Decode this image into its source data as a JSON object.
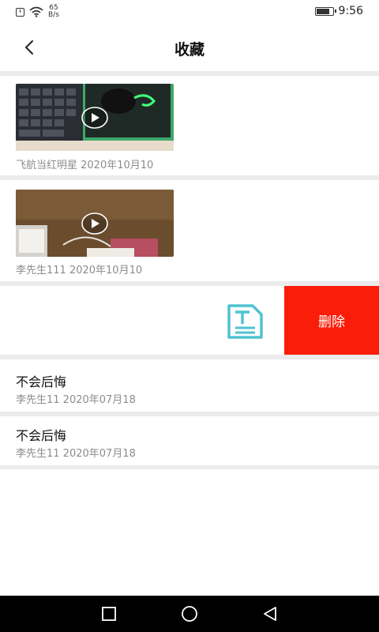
{
  "status_bar": {
    "net_speed_value": "65",
    "net_speed_unit": "B/s",
    "time": "9:56",
    "battery_level": 0.85,
    "icons": [
      "alert-icon",
      "wifi-icon",
      "battery-icon"
    ]
  },
  "header": {
    "title": "收藏",
    "back_icon": "back-arrow-icon"
  },
  "items": [
    {
      "type": "video",
      "meta": "飞航当红明星 2020年10月10"
    },
    {
      "type": "video",
      "meta": "李先生111 2020年10月10"
    },
    {
      "type": "text",
      "icon": "text-doc-icon",
      "delete_label": "删除"
    },
    {
      "type": "text",
      "title": "不会后悔",
      "meta": "李先生11 2020年07月18"
    },
    {
      "type": "text",
      "title": "不会后悔",
      "meta": "李先生11 2020年07月18"
    }
  ],
  "colors": {
    "delete_bg": "#fa1e0a",
    "doc_icon": "#4fc3d1",
    "divider": "#ebebeb"
  },
  "nav_bar": {
    "buttons": [
      "recent-apps-icon",
      "home-icon",
      "back-triangle-icon"
    ]
  }
}
